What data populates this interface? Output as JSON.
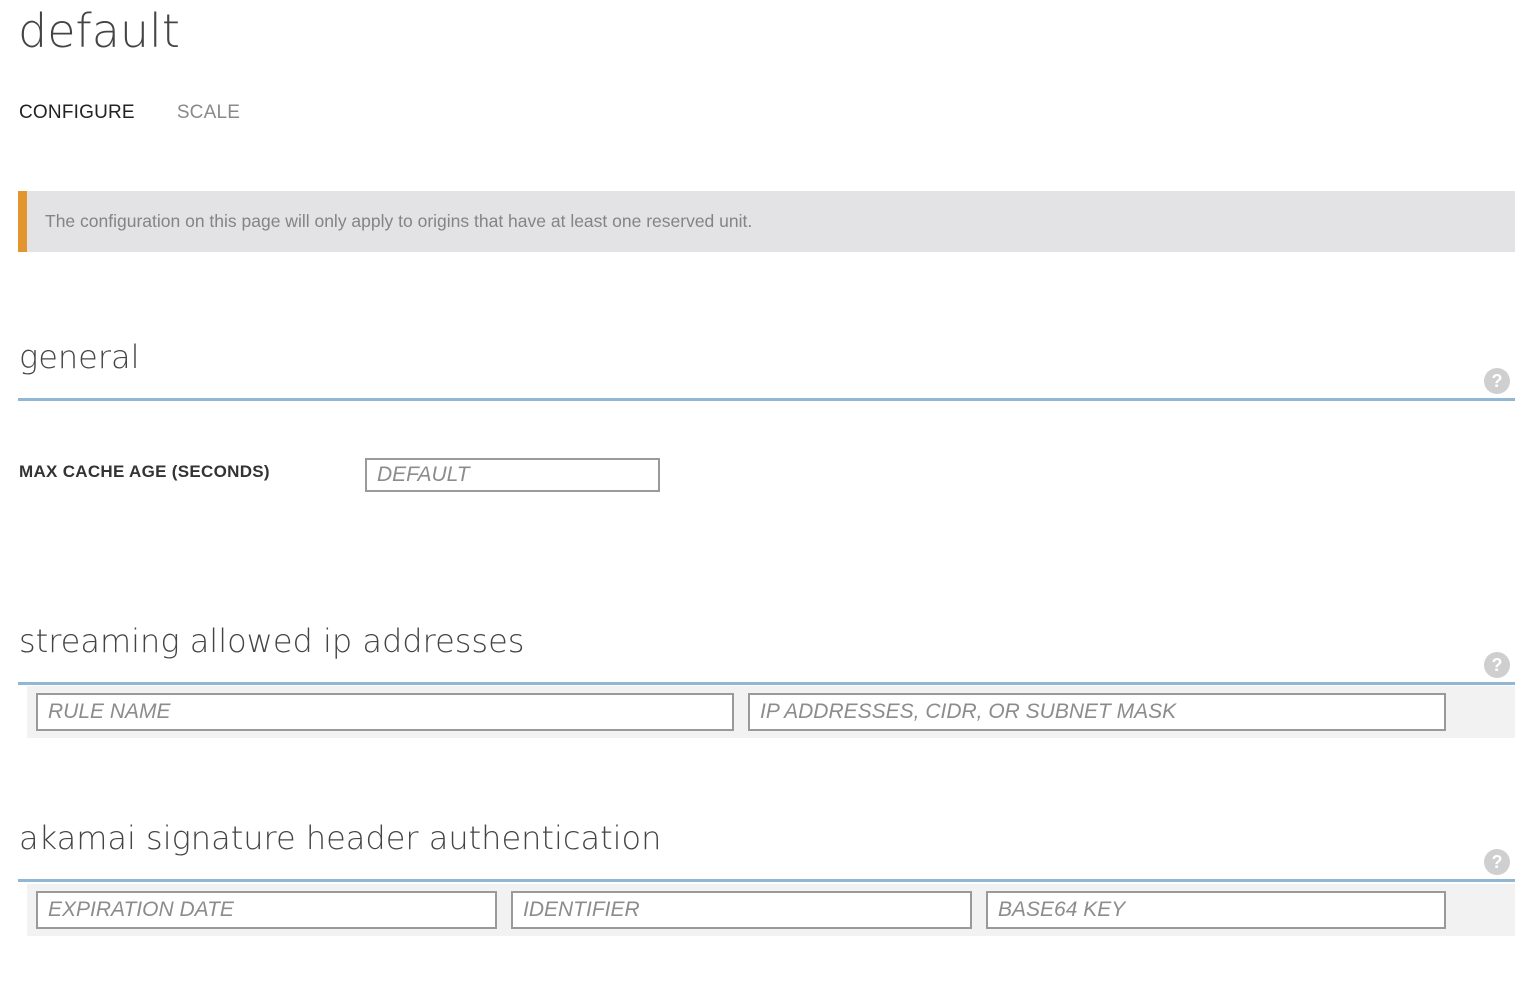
{
  "page": {
    "title": "default"
  },
  "tabs": [
    {
      "label": "CONFIGURE",
      "active": true
    },
    {
      "label": "SCALE",
      "active": false
    }
  ],
  "notice": {
    "text": "The configuration on this page will only apply to origins that have at least one reserved unit.",
    "accent_color": "#e3962f"
  },
  "general": {
    "title": "general",
    "help_icon": "question-icon",
    "max_cache_age": {
      "label": "MAX CACHE AGE (SECONDS)",
      "placeholder": "DEFAULT",
      "value": ""
    }
  },
  "streaming_ip": {
    "title": "streaming allowed ip addresses",
    "help_icon": "question-icon",
    "rule_name_placeholder": "RULE NAME",
    "ip_placeholder": "IP ADDRESSES, CIDR, OR SUBNET MASK"
  },
  "akamai": {
    "title": "akamai signature header authentication",
    "help_icon": "question-icon",
    "expiration_placeholder": "EXPIRATION DATE",
    "identifier_placeholder": "IDENTIFIER",
    "key_placeholder": "BASE64 KEY"
  },
  "colors": {
    "section_rule": "#91b7d4",
    "notice_background": "#e3e3e5"
  }
}
